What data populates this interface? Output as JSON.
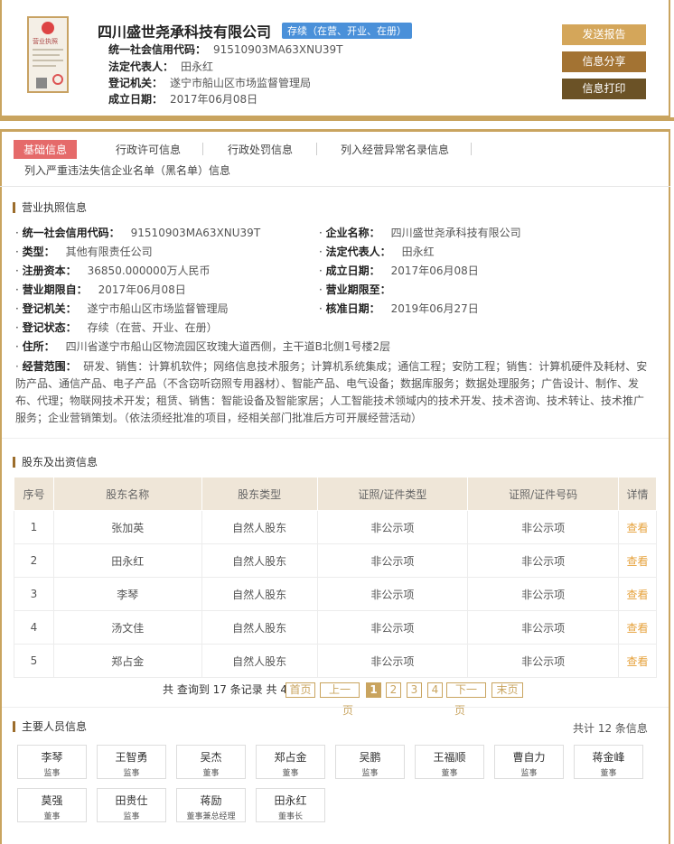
{
  "company": {
    "name": "四川盛世尧承科技有限公司",
    "status": "存续（在营、开业、在册）",
    "license_text": "营业执照",
    "fields": [
      {
        "label": "统一社会信用代码：",
        "value": "91510903MA63XNU39T"
      },
      {
        "label": "法定代表人：",
        "value": "田永红"
      },
      {
        "label": "登记机关：",
        "value": "遂宁市船山区市场监督管理局"
      },
      {
        "label": "成立日期：",
        "value": "2017年06月08日"
      }
    ]
  },
  "actions": {
    "send_report": "发送报告",
    "share": "信息分享",
    "print": "信息打印"
  },
  "colors": {
    "gold": "#c9a45f",
    "btn1": "#d4a65a",
    "btn2": "#a37333",
    "btn3": "#6b5226",
    "tab_active": "#e56a6a",
    "status": "#4a90d9"
  },
  "tabs": [
    "基础信息",
    "行政许可信息",
    "行政处罚信息",
    "列入经营异常名录信息",
    "列入严重违法失信企业名单（黑名单）信息"
  ],
  "license_section": {
    "title": "营业执照信息",
    "fields": {
      "credit_code": {
        "label": "统一社会信用代码：",
        "value": "91510903MA63XNU39T"
      },
      "company_name": {
        "label": "企业名称：",
        "value": "四川盛世尧承科技有限公司"
      },
      "type": {
        "label": "类型：",
        "value": "其他有限责任公司"
      },
      "legal_rep": {
        "label": "法定代表人：",
        "value": "田永红"
      },
      "capital": {
        "label": "注册资本：",
        "value": "36850.000000万人民币"
      },
      "founded": {
        "label": "成立日期：",
        "value": "2017年06月08日"
      },
      "term_from": {
        "label": "营业期限自：",
        "value": "2017年06月08日"
      },
      "term_to": {
        "label": "营业期限至：",
        "value": ""
      },
      "authority": {
        "label": "登记机关：",
        "value": "遂宁市船山区市场监督管理局"
      },
      "approve_date": {
        "label": "核准日期：",
        "value": "2019年06月27日"
      },
      "reg_status": {
        "label": "登记状态：",
        "value": "存续（在营、开业、在册）"
      },
      "address": {
        "label": "住所：",
        "value": "四川省遂宁市船山区物流园区玫瑰大道西侧，主干道B北侧1号楼2层"
      },
      "scope_label": "经营范围：",
      "scope_line1": "研发、销售：计算机软件；网络信息技术服务；计算机系统集成；通信工程；安防工程；销售：计算机硬件及耗材、安",
      "scope_line2": "防产品、通信产品、电子产品（不含窃听窃照专用器材）、智能产品、电气设备；数据库服务；数据处理服务；广告设计、制作、发",
      "scope_line3": "布、代理；物联网技术开发；租赁、销售：智能设备及智能家居；人工智能技术领域内的技术开发、技术咨询、技术转让、技术推广",
      "scope_line4": "服务；企业营销策划。（依法须经批准的项目，经相关部门批准后方可开展经营活动）"
    }
  },
  "shareholders": {
    "title": "股东及出资信息",
    "columns": [
      "序号",
      "股东名称",
      "股东类型",
      "证照/证件类型",
      "证照/证件号码",
      "详情"
    ],
    "rows": [
      {
        "no": "1",
        "name": "张加英",
        "type": "自然人股东",
        "id_type": "非公示项",
        "id_no": "非公示项",
        "detail": "查看"
      },
      {
        "no": "2",
        "name": "田永红",
        "type": "自然人股东",
        "id_type": "非公示项",
        "id_no": "非公示项",
        "detail": "查看"
      },
      {
        "no": "3",
        "name": "李琴",
        "type": "自然人股东",
        "id_type": "非公示项",
        "id_no": "非公示项",
        "detail": "查看"
      },
      {
        "no": "4",
        "name": "汤文佳",
        "type": "自然人股东",
        "id_type": "非公示项",
        "id_no": "非公示项",
        "detail": "查看"
      },
      {
        "no": "5",
        "name": "郑占金",
        "type": "自然人股东",
        "id_type": "非公示项",
        "id_no": "非公示项",
        "detail": "查看"
      }
    ],
    "pager": {
      "summary": "共 查询到 17 条记录 共 4 页",
      "first": "首页",
      "prev": "上一",
      "prev_sub": "页",
      "pages": [
        "1",
        "2",
        "3",
        "4"
      ],
      "current": "1",
      "next": "下一",
      "next_sub": "页",
      "last": "末页"
    }
  },
  "personnel": {
    "title": "主要人员信息",
    "total": "共计 12 条信息",
    "people": [
      {
        "name": "李琴",
        "role": "监事"
      },
      {
        "name": "王智勇",
        "role": "监事"
      },
      {
        "name": "吴杰",
        "role": "董事"
      },
      {
        "name": "郑占金",
        "role": "董事"
      },
      {
        "name": "吴鹏",
        "role": "监事"
      },
      {
        "name": "王福顺",
        "role": "董事"
      },
      {
        "name": "曹自力",
        "role": "监事"
      },
      {
        "name": "蒋金峰",
        "role": "董事"
      },
      {
        "name": "莫强",
        "role": "董事"
      },
      {
        "name": "田贵仕",
        "role": "监事"
      },
      {
        "name": "蒋励",
        "role": "董事兼总经理"
      },
      {
        "name": "田永红",
        "role": "董事长"
      }
    ]
  }
}
